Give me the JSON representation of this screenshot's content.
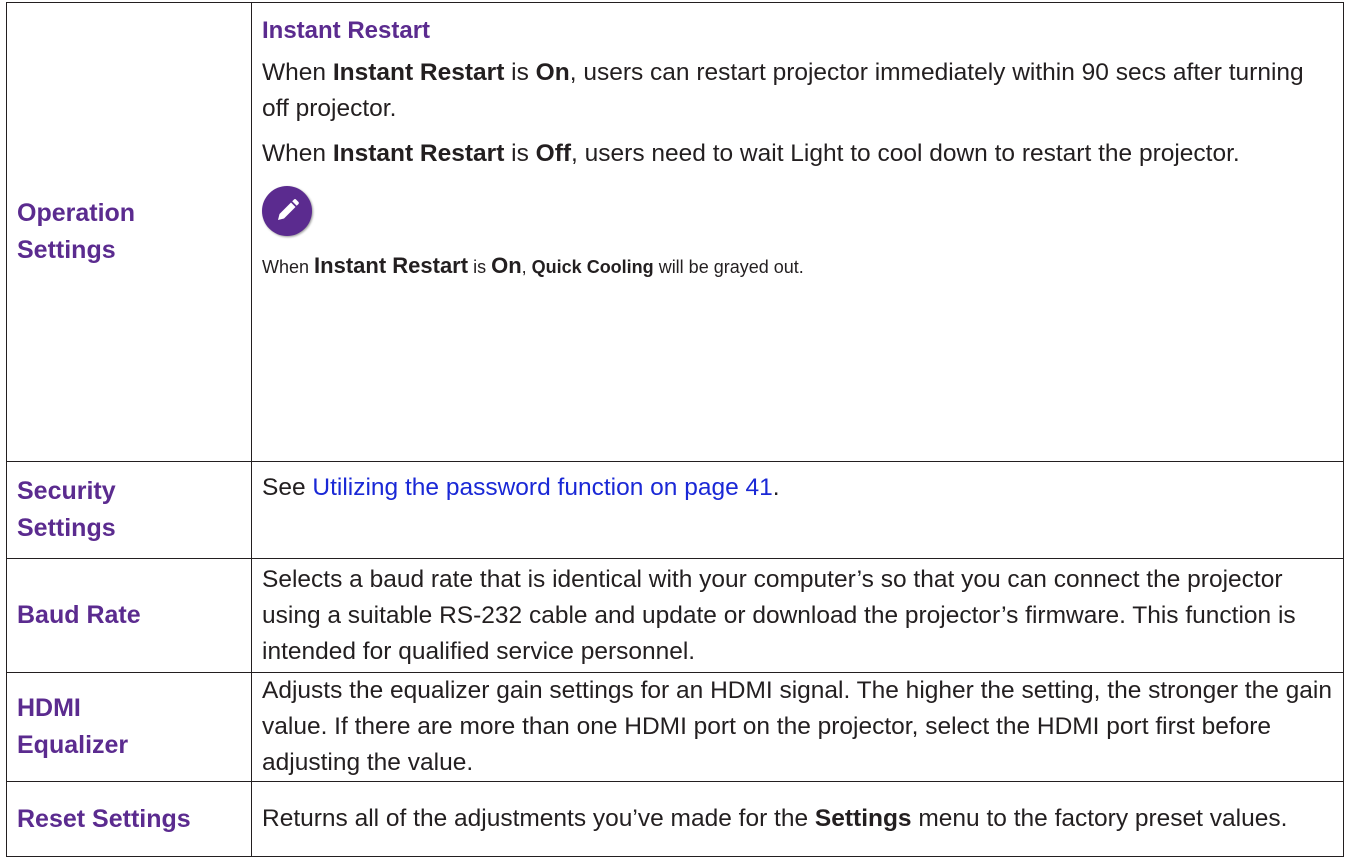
{
  "rows": {
    "operation": {
      "label_line1": "Operation",
      "label_line2": "Settings",
      "heading": "Instant Restart",
      "p1": {
        "t1": "When ",
        "b1": "Instant Restart",
        "t2": " is ",
        "b2": "On",
        "t3": ", users can restart projector immediately within 90 secs after turning off projector."
      },
      "p2": {
        "t1": "When ",
        "b1": "Instant Restart",
        "t2": " is ",
        "b2": "Off",
        "t3": ", users need to wait Light to cool down to restart the projector."
      },
      "note": {
        "icon": "pencil-note-icon",
        "t1": "When ",
        "b1": "Instant Restart",
        "t2": " is ",
        "b2": "On",
        "t3": ", ",
        "b3": "Quick Cooling",
        "t4": " will be grayed out."
      }
    },
    "security": {
      "label_line1": "Security",
      "label_line2": "Settings",
      "prefix": "See ",
      "link": "Utilizing the password function on page 41",
      "suffix": "."
    },
    "baud": {
      "label": "Baud Rate",
      "text": "Selects a baud rate that is identical with your computer’s so that you can connect the projector using a suitable RS-232 cable and update or download the projector’s firmware. This function is intended for qualified service personnel."
    },
    "hdmi": {
      "label_line1": "HDMI",
      "label_line2": "Equalizer",
      "text": "Adjusts the equalizer gain settings for an HDMI signal. The higher the setting, the stronger the gain value. If there are more than one HDMI port on the projector, select the HDMI port first before adjusting the value."
    },
    "reset": {
      "label": "Reset Settings",
      "t1": "Returns all of the adjustments you’ve made for the ",
      "b1": "Settings",
      "t2": " menu to the factory preset values."
    }
  },
  "colors": {
    "label": "#5b2b8f",
    "link": "#1a28d6",
    "text": "#231f20"
  }
}
